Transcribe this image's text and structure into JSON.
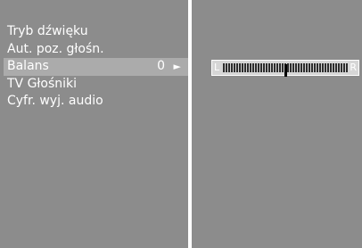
{
  "menu": {
    "items": [
      {
        "label": "Tryb dźwięku"
      },
      {
        "label": "Aut. poz. głośn."
      },
      {
        "label": "Balans",
        "value": "0",
        "arrow": "►"
      },
      {
        "label": "TV Głośniki"
      },
      {
        "label": "Cyfr. wyj. audio"
      }
    ],
    "selected_index": 2
  },
  "balance": {
    "left_label": "L",
    "right_label": "R",
    "value": 0,
    "min": -50,
    "max": 50
  },
  "colors": {
    "panel": "#8c8c8c",
    "selected": "#ababab",
    "text": "#ffffff"
  }
}
